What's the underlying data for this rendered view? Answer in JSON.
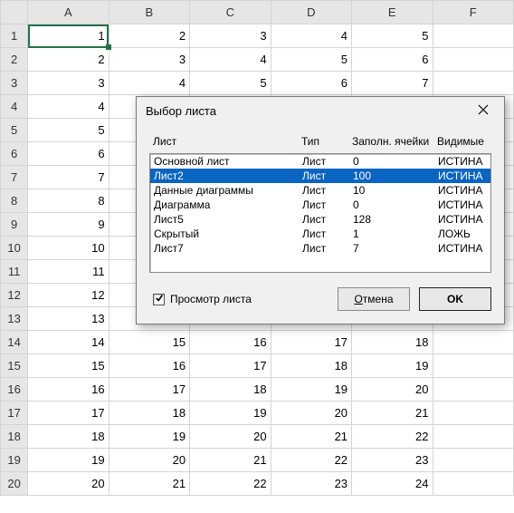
{
  "dialog": {
    "title": "Выбор листа",
    "headers": {
      "sheet": "Лист",
      "type": "Тип",
      "filled": "Заполн. ячейки",
      "visible": "Видимые"
    },
    "rows": [
      {
        "name": "Основной лист",
        "type": "Лист",
        "filled": "0",
        "visible": "ИСТИНА",
        "selected": false
      },
      {
        "name": "Лист2",
        "type": "Лист",
        "filled": "100",
        "visible": "ИСТИНА",
        "selected": true
      },
      {
        "name": "Данные диаграммы",
        "type": "Лист",
        "filled": "10",
        "visible": "ИСТИНА",
        "selected": false
      },
      {
        "name": "Диаграмма",
        "type": "Лист",
        "filled": "0",
        "visible": "ИСТИНА",
        "selected": false
      },
      {
        "name": "Лист5",
        "type": "Лист",
        "filled": "128",
        "visible": "ИСТИНА",
        "selected": false
      },
      {
        "name": "Скрытый",
        "type": "Лист",
        "filled": "1",
        "visible": "ЛОЖЬ",
        "selected": false
      },
      {
        "name": "Лист7",
        "type": "Лист",
        "filled": "7",
        "visible": "ИСТИНА",
        "selected": false
      }
    ],
    "checkbox_label": "Просмотр листа",
    "checkbox_checked": true,
    "cancel_label": "Отмена",
    "ok_label": "OK"
  },
  "sheet": {
    "columns": [
      "A",
      "B",
      "C",
      "D",
      "E",
      "F"
    ],
    "row_count": 20,
    "active": {
      "row": 1,
      "col": 0
    },
    "start_values": [
      1,
      2,
      3,
      4,
      5,
      null
    ]
  }
}
